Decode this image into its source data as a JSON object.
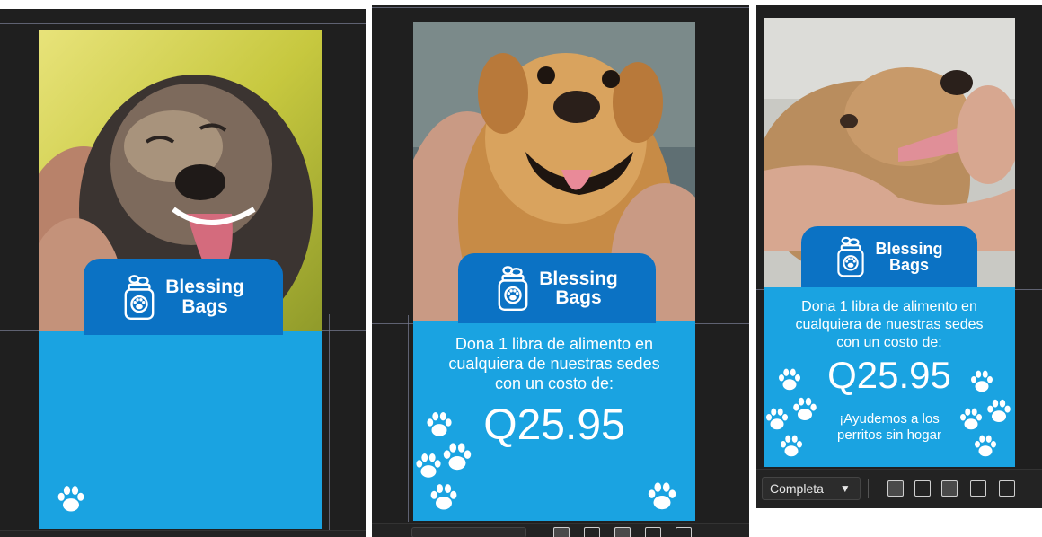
{
  "brand": {
    "line1": "Blessing",
    "line2": "Bags"
  },
  "donation": {
    "line1": "Dona 1 libra de alimento en",
    "line2": "cualquiera de nuestras sedes",
    "line3": "con un costo de:",
    "price": "Q25.95"
  },
  "slogan": {
    "line1": "¡Ayudemos a los",
    "line2": "perritos sin hogar"
  },
  "toolbar": {
    "view_mode": "Completa"
  },
  "colors": {
    "panel_bg": "#1f1f1f",
    "light_blue": "#1aa3e1",
    "dark_blue": "#0b72c4",
    "text": "#ffffff"
  }
}
